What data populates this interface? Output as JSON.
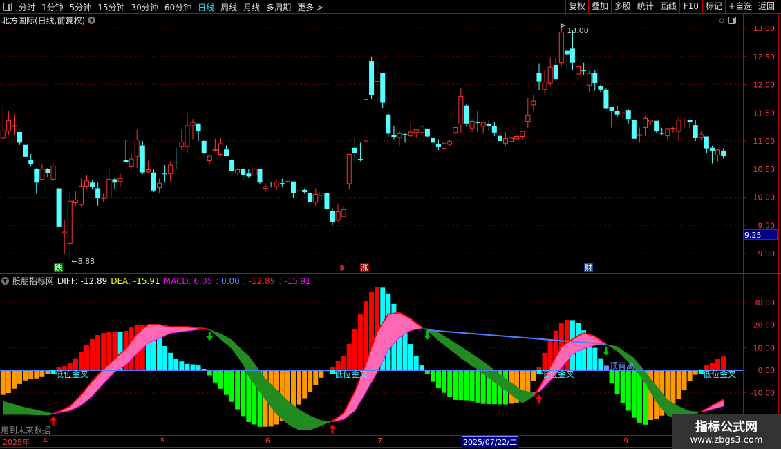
{
  "toolbar": {
    "left_items": [
      "分时",
      "1分钟",
      "5分钟",
      "15分钟",
      "30分钟",
      "60分钟",
      "日线",
      "周线",
      "月线",
      "多周期",
      "更多 >"
    ],
    "active_item": "日线",
    "right_buttons": [
      "复权",
      "叠加",
      "多股",
      "统计",
      "画线",
      "F10",
      "标记",
      "+自选",
      "返回"
    ]
  },
  "title": "北方国际(日线,前复权)",
  "price_axis": {
    "labels": [
      "13.00",
      "12.50",
      "12.00",
      "11.50",
      "11.00",
      "10.50",
      "10.00",
      "9.50",
      "9.00"
    ],
    "current": "9.25"
  },
  "annotations": {
    "high": "13.00",
    "low": "←8.88"
  },
  "markers": {
    "die": "跌",
    "dollar": "$",
    "zhang": "涨",
    "cai": "财"
  },
  "indicator": {
    "name": "股朋指标网",
    "diff_label": "DIFF: -12.89",
    "dea_label": "DEA: -15.91",
    "macd_label": "MACD: 6.05",
    "v4": ": 0.00",
    "v5": ": -12.89",
    "v6": ": -15.91",
    "axis_labels": [
      "30.00",
      "20.00",
      "10.00",
      "0.00",
      "-10.00"
    ],
    "golden_cross_label": "低位金叉",
    "divergence_label": "顶背离",
    "future_note": "用到未来数据"
  },
  "time_axis": {
    "year": "2025年",
    "months": [
      "4",
      "5",
      "6",
      "7",
      "9"
    ],
    "selected_date": "2025/07/22/二"
  },
  "watermark": {
    "line1": "指标公式网",
    "line2": "www.zbgs3.com"
  },
  "colors": {
    "up": "#ff3232",
    "down": "#54ffff",
    "hist_red": "#ff0000",
    "hist_cyan": "#00ffff",
    "hist_green": "#00ff00",
    "hist_orange": "#ff9900",
    "ribbon_up": "#ff69b4",
    "ribbon_down": "#228b22",
    "zero_line": "#4f7fff"
  },
  "chart_data": [
    {
      "type": "candlestick",
      "ylim": [
        8.8,
        13.05
      ],
      "ohlc": [
        [
          11.05,
          11.62,
          11.03,
          11.18
        ],
        [
          11.18,
          11.54,
          11.1,
          11.36
        ],
        [
          11.26,
          11.47,
          11.1,
          11.27
        ],
        [
          11.16,
          11.16,
          10.93,
          10.97
        ],
        [
          10.93,
          10.93,
          10.71,
          10.72
        ],
        [
          10.66,
          10.77,
          10.55,
          10.59
        ],
        [
          10.5,
          10.52,
          10.06,
          10.26
        ],
        [
          10.32,
          10.6,
          10.32,
          10.5
        ],
        [
          10.5,
          10.52,
          10.36,
          10.43
        ],
        [
          10.32,
          10.6,
          10.29,
          10.55
        ],
        [
          10.16,
          10.16,
          9.48,
          9.48
        ],
        [
          9.36,
          9.6,
          9.0,
          9.38
        ],
        [
          9.18,
          10.1,
          8.88,
          9.93
        ],
        [
          9.9,
          10.11,
          9.85,
          9.95
        ],
        [
          9.87,
          10.33,
          9.82,
          10.2
        ],
        [
          10.2,
          10.39,
          10.16,
          10.29
        ],
        [
          10.26,
          10.3,
          10.14,
          10.18
        ],
        [
          10.16,
          10.26,
          9.85,
          9.98
        ],
        [
          9.98,
          10.06,
          9.92,
          9.99
        ],
        [
          9.99,
          10.5,
          9.99,
          10.32
        ],
        [
          10.32,
          10.35,
          10.15,
          10.26
        ],
        [
          10.28,
          10.42,
          10.2,
          10.33
        ],
        [
          10.66,
          11.02,
          10.62,
          10.62
        ],
        [
          10.54,
          10.77,
          10.53,
          10.68
        ],
        [
          10.72,
          11.2,
          10.52,
          11.02
        ],
        [
          10.92,
          11.0,
          10.41,
          10.44
        ],
        [
          10.45,
          10.65,
          10.42,
          10.49
        ],
        [
          10.44,
          10.49,
          10.09,
          10.12
        ],
        [
          10.17,
          10.33,
          10.07,
          10.25
        ],
        [
          10.42,
          10.57,
          10.26,
          10.41
        ],
        [
          10.42,
          10.64,
          10.28,
          10.57
        ],
        [
          10.63,
          10.88,
          10.5,
          10.62
        ],
        [
          10.9,
          11.2,
          10.84,
          10.98
        ],
        [
          10.9,
          11.49,
          10.78,
          11.27
        ],
        [
          11.27,
          11.39,
          11.03,
          11.33
        ],
        [
          11.31,
          11.31,
          11.0,
          11.17
        ],
        [
          11.0,
          11.01,
          10.77,
          10.78
        ],
        [
          10.65,
          10.73,
          10.6,
          10.73
        ],
        [
          10.84,
          11.04,
          10.81,
          10.85
        ],
        [
          10.76,
          11.05,
          10.73,
          10.95
        ],
        [
          10.85,
          10.92,
          10.73,
          10.73
        ],
        [
          10.66,
          10.72,
          10.42,
          10.47
        ],
        [
          10.43,
          10.49,
          10.4,
          10.49
        ],
        [
          10.5,
          10.5,
          10.31,
          10.39
        ],
        [
          10.42,
          10.5,
          10.34,
          10.37
        ],
        [
          10.39,
          10.52,
          10.39,
          10.5
        ],
        [
          10.5,
          10.5,
          10.24,
          10.26
        ],
        [
          10.16,
          10.25,
          10.11,
          10.19
        ],
        [
          10.19,
          10.27,
          10.18,
          10.18
        ],
        [
          10.19,
          10.3,
          10.13,
          10.27
        ],
        [
          10.25,
          10.33,
          10.18,
          10.24
        ],
        [
          10.29,
          10.33,
          10.24,
          10.29
        ],
        [
          10.28,
          10.28,
          9.99,
          10.07
        ],
        [
          10.12,
          10.27,
          10.09,
          10.12
        ],
        [
          10.13,
          10.16,
          10.06,
          10.09
        ],
        [
          10.07,
          10.07,
          9.89,
          9.92
        ],
        [
          9.91,
          10.16,
          9.85,
          10.05
        ],
        [
          10.03,
          10.07,
          9.94,
          10.07
        ],
        [
          10.07,
          10.07,
          9.78,
          9.79
        ],
        [
          9.76,
          9.8,
          9.5,
          9.56
        ],
        [
          9.59,
          9.87,
          9.57,
          9.74
        ],
        [
          9.66,
          9.85,
          9.66,
          9.78
        ],
        [
          10.24,
          10.76,
          10.15,
          10.76
        ],
        [
          10.88,
          11.05,
          10.62,
          10.79
        ],
        [
          10.68,
          10.97,
          10.64,
          10.68
        ],
        [
          11.0,
          11.73,
          11.0,
          11.73
        ],
        [
          12.41,
          12.5,
          11.74,
          11.81
        ],
        [
          12.06,
          12.5,
          11.63,
          12.1
        ],
        [
          12.21,
          12.21,
          11.58,
          11.68
        ],
        [
          11.47,
          11.48,
          11.07,
          11.13
        ],
        [
          11.11,
          11.26,
          11.03,
          11.07
        ],
        [
          11.06,
          11.17,
          10.91,
          11.13
        ],
        [
          11.12,
          11.14,
          10.97,
          11.12
        ],
        [
          11.09,
          11.33,
          11.05,
          11.16
        ],
        [
          11.15,
          11.2,
          11.05,
          11.2
        ],
        [
          11.15,
          11.3,
          11.08,
          11.26
        ],
        [
          11.21,
          11.21,
          11.07,
          11.08
        ],
        [
          11.05,
          11.1,
          10.89,
          10.97
        ],
        [
          10.94,
          11.03,
          10.84,
          10.89
        ],
        [
          10.87,
          10.96,
          10.85,
          10.96
        ],
        [
          10.94,
          11.02,
          10.9,
          10.99
        ],
        [
          11.15,
          11.24,
          11.09,
          11.24
        ],
        [
          11.3,
          11.93,
          11.15,
          11.79
        ],
        [
          11.63,
          11.65,
          11.25,
          11.31
        ],
        [
          11.22,
          11.39,
          11.16,
          11.35
        ],
        [
          11.33,
          11.54,
          11.16,
          11.33
        ],
        [
          11.26,
          11.33,
          11.13,
          11.33
        ],
        [
          11.3,
          11.38,
          11.18,
          11.26
        ],
        [
          11.27,
          11.34,
          11.09,
          11.15
        ],
        [
          11.09,
          11.15,
          10.97,
          11.0
        ],
        [
          10.96,
          11.15,
          10.92,
          11.04
        ],
        [
          10.99,
          11.05,
          10.95,
          11.05
        ],
        [
          11.04,
          11.1,
          11.02,
          11.08
        ],
        [
          11.08,
          11.18,
          11.03,
          11.17
        ],
        [
          11.35,
          11.76,
          11.23,
          11.45
        ],
        [
          11.64,
          11.81,
          11.53,
          11.71
        ],
        [
          12.21,
          12.38,
          11.9,
          12.06
        ],
        [
          11.91,
          12.25,
          11.85,
          12.05
        ],
        [
          12.03,
          12.48,
          11.97,
          12.31
        ],
        [
          12.35,
          12.48,
          12.07,
          12.09
        ],
        [
          12.39,
          13.0,
          12.33,
          12.93
        ],
        [
          12.6,
          12.65,
          12.24,
          12.54
        ],
        [
          12.64,
          12.97,
          12.26,
          12.39
        ],
        [
          12.19,
          12.46,
          12.15,
          12.32
        ],
        [
          12.25,
          12.39,
          12.17,
          12.25
        ],
        [
          11.99,
          12.25,
          11.87,
          12.2
        ],
        [
          12.21,
          12.26,
          11.89,
          12.03
        ],
        [
          11.97,
          11.99,
          11.87,
          11.91
        ],
        [
          11.91,
          11.93,
          11.57,
          11.57
        ],
        [
          11.6,
          11.6,
          11.24,
          11.54
        ],
        [
          11.53,
          11.62,
          11.42,
          11.47
        ],
        [
          11.46,
          11.54,
          11.39,
          11.5
        ],
        [
          11.55,
          11.56,
          11.3,
          11.39
        ],
        [
          11.38,
          11.38,
          11.01,
          11.04
        ],
        [
          11.1,
          11.24,
          10.97,
          11.11
        ],
        [
          11.24,
          11.44,
          11.09,
          11.4
        ],
        [
          11.34,
          11.37,
          11.29,
          11.37
        ],
        [
          11.36,
          11.36,
          11.15,
          11.17
        ],
        [
          11.14,
          11.22,
          11.1,
          11.14
        ],
        [
          11.09,
          11.21,
          11.03,
          11.21
        ],
        [
          11.22,
          11.25,
          11.15,
          11.22
        ],
        [
          11.17,
          11.42,
          11.0,
          11.37
        ],
        [
          11.38,
          11.4,
          11.25,
          11.38
        ],
        [
          11.37,
          11.37,
          11.22,
          11.33
        ],
        [
          11.28,
          11.37,
          11.0,
          11.05
        ],
        [
          11.06,
          11.17,
          11.02,
          11.11
        ],
        [
          11.08,
          11.08,
          10.78,
          10.87
        ],
        [
          10.88,
          10.91,
          10.6,
          10.83
        ],
        [
          10.75,
          10.86,
          10.62,
          10.84
        ],
        [
          10.83,
          10.87,
          10.69,
          10.73
        ]
      ]
    },
    {
      "type": "macd",
      "ylim": [
        -30,
        40
      ],
      "hist": [
        -10.9,
        -10.1,
        -8.2,
        -6.1,
        -4.5,
        -4.0,
        -3.6,
        -3.0,
        -1.7,
        -0.3,
        1.2,
        1.8,
        3.1,
        5.3,
        8.0,
        11.0,
        13.8,
        15.6,
        16.5,
        17.1,
        17.1,
        17.0,
        17.4,
        18.9,
        20.0,
        20.0,
        19.7,
        17.0,
        14.1,
        10.7,
        7.7,
        5.2,
        3.9,
        2.8,
        2.6,
        2.1,
        0.6,
        -2.3,
        -5.4,
        -8.2,
        -10.9,
        -14.0,
        -17.3,
        -20.3,
        -22.9,
        -24.0,
        -25.0,
        -25.0,
        -24.9,
        -24.0,
        -22.6,
        -20.4,
        -18.1,
        -15.2,
        -12.4,
        -9.7,
        -6.6,
        -3.3,
        -0.4,
        1.5,
        4.0,
        6.4,
        11.6,
        18.4,
        24.8,
        30.6,
        34.6,
        36.7,
        36.6,
        34.0,
        29.4,
        23.5,
        17.6,
        11.6,
        6.4,
        2.1,
        -1.7,
        -5.1,
        -7.9,
        -10.0,
        -11.8,
        -13.1,
        -13.2,
        -13.3,
        -13.5,
        -14.3,
        -14.9,
        -15.0,
        -15.05,
        -15.1,
        -15.15,
        -14.8,
        -14.3,
        -12.8,
        -9.8,
        -4.6,
        1.5,
        7.7,
        13.4,
        17.5,
        20.8,
        22.3,
        22.2,
        20.8,
        17.7,
        14.2,
        9.9,
        5.3,
        0.3,
        -5.7,
        -10.6,
        -14.6,
        -17.9,
        -21.0,
        -23.2,
        -24.1,
        -22.0,
        -21.5,
        -20.1,
        -17.8,
        -15.6,
        -12.6,
        -8.9,
        -4.8,
        -2.0,
        0.5,
        2.1,
        3.4,
        4.9,
        6.05
      ],
      "diff": [
        -19.6,
        -19.6,
        -19.6,
        -19.6,
        -19.6,
        -19.7,
        -19.8,
        -19.8,
        -19.9,
        -19.4,
        -18.3,
        -17.1,
        -16.0,
        -13.5,
        -10.9,
        -7.9,
        -4.8,
        -2.2,
        0.5,
        2.8,
        5.1,
        7.3,
        9.5,
        12.8,
        16.1,
        18.2,
        20.2,
        20.2,
        20.2,
        19.7,
        19.2,
        19.2,
        19.2,
        19.2,
        19.0,
        18.7,
        18.5,
        17.9,
        15.8,
        13.6,
        11.6,
        9.5,
        6.1,
        2.6,
        -2.8,
        -6.2,
        -9.6,
        -13.0,
        -16.3,
        -19.5,
        -21.7,
        -23.8,
        -25.2,
        -26.5,
        -26.5,
        -26.4,
        -25.5,
        -24.5,
        -23.5,
        -22.5,
        -20.8,
        -19.0,
        -14.3,
        -9.5,
        -3.3,
        3.0,
        10.0,
        17.0,
        20.9,
        24.8,
        25.2,
        25.5,
        24.2,
        22.8,
        20.9,
        19.0,
        17.5,
        15.3,
        13.1,
        11.2,
        9.3,
        7.4,
        5.4,
        3.7,
        1.9,
        0.2,
        -1.6,
        -3.4,
        -5.3,
        -7.1,
        -8.9,
        -10.8,
        -12.6,
        -14.5,
        -13.0,
        -11.5,
        -8.0,
        -3.3,
        1.5,
        6.0,
        10.5,
        12.2,
        13.8,
        15.2,
        16.5,
        15.8,
        15.0,
        13.3,
        11.5,
        10.0,
        8.5,
        6.1,
        3.7,
        1.3,
        -2.3,
        -5.8,
        -9.9,
        -14.0,
        -17.1,
        -20.1,
        -20.6,
        -21.1,
        -20.6,
        -20.1,
        -19.3,
        -18.4,
        -17.0,
        -15.6,
        -14.3,
        -12.89
      ],
      "dea": [
        -13.7,
        -14.4,
        -15.1,
        -15.8,
        -16.5,
        -17.0,
        -17.5,
        -18.1,
        -18.6,
        -19.2,
        -18.8,
        -18.3,
        -17.9,
        -16.7,
        -15.5,
        -13.5,
        -11.4,
        -8.6,
        -5.8,
        -3.3,
        -0.7,
        0.8,
        2.3,
        4.9,
        7.4,
        9.7,
        12.0,
        13.1,
        14.1,
        15.3,
        16.4,
        16.7,
        17.1,
        17.4,
        17.7,
        18.0,
        18.3,
        18.0,
        17.1,
        16.1,
        14.8,
        13.4,
        11.0,
        8.5,
        6.4,
        3.0,
        -0.4,
        -3.8,
        -6.2,
        -8.5,
        -11.0,
        -13.5,
        -15.4,
        -17.3,
        -18.8,
        -20.2,
        -21.2,
        -22.2,
        -22.5,
        -22.8,
        -22.3,
        -21.7,
        -19.9,
        -18.0,
        -13.8,
        -9.5,
        -5.3,
        -1.0,
        4.0,
        9.0,
        11.8,
        14.5,
        16.1,
        17.6,
        18.1,
        18.6,
        18.4,
        17.5,
        16.6,
        15.1,
        13.6,
        12.0,
        10.5,
        8.9,
        7.2,
        5.6,
        3.9,
        2.0,
        0.0,
        -1.9,
        -3.8,
        -5.5,
        -7.2,
        -8.9,
        -9.4,
        -9.9,
        -9.6,
        -7.1,
        -4.5,
        -1.7,
        1.2,
        4.1,
        7.0,
        8.4,
        9.7,
        10.4,
        11.1,
        11.3,
        11.4,
        11.0,
        10.5,
        8.8,
        7.1,
        5.4,
        2.4,
        -0.7,
        -3.8,
        -6.8,
        -9.9,
        -13.0,
        -14.5,
        -16.0,
        -17.1,
        -18.1,
        -18.3,
        -18.5,
        -17.9,
        -17.2,
        -16.6,
        -15.91
      ],
      "golden_cross_bars": [
        10,
        60,
        97,
        126
      ],
      "death_cross_bars": [
        38,
        77,
        109
      ],
      "divergence_line": {
        "from_bar": 77,
        "from_value": 17.8,
        "to_bar": 109,
        "to_value": 11.5
      }
    }
  ]
}
